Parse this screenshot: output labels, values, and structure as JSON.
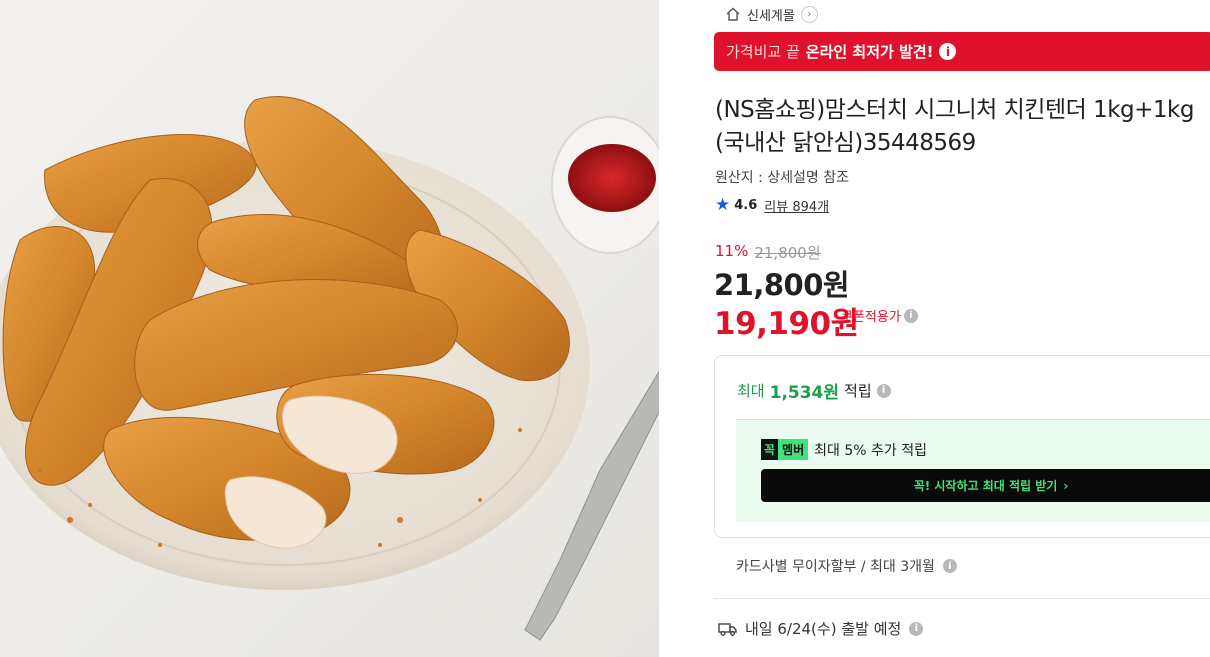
{
  "store": {
    "name": "신세계몰",
    "home_icon": "home-icon",
    "chevron": "›"
  },
  "banner": {
    "prefix": "가격비교 끝",
    "highlight": "온라인 최저가 발견!",
    "info": "i"
  },
  "product": {
    "title_line1": "(NS홈쇼핑)맘스터치 시그니처 치킨텐더 1kg+1kg",
    "title_line2": "(국내산 닭안심)35448569",
    "origin": "원산지 : 상세설명 참조",
    "rating": "4.6",
    "review_label": "리뷰 894개"
  },
  "price": {
    "discount_pct": "11%",
    "original": "21,800원",
    "current": "21,800원",
    "coupon_price": "19,190원",
    "coupon_label": "쿠폰적용가"
  },
  "benefits": {
    "reward_prefix": "최대",
    "reward_amount": "1,534원",
    "reward_suffix": "적립",
    "member_tag1": "꼭",
    "member_tag2": "멤버",
    "member_text": "최대 5% 추가 적립",
    "member_button": "꼭! 시작하고 최대 적립 받기",
    "member_button_arrow": "›"
  },
  "installment": "카드사별 무이자할부 / 최대 3개월",
  "delivery": "내일 6/24(수) 출발 예정",
  "colors": {
    "accent_red": "#e0112b",
    "green": "#19a14a",
    "mint": "#41e27d"
  }
}
